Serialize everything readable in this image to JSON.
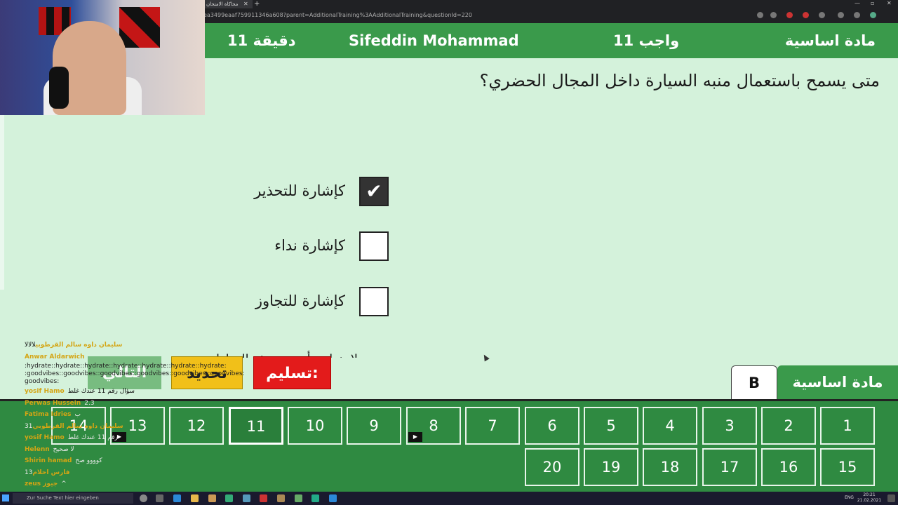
{
  "browser": {
    "tab_title": "محاكاة الامتحان",
    "url": "ea3499eaaf759911346a608?parent=AdditionalTraining%3AAdditionalTraining&questionId=220"
  },
  "header": {
    "subject": "مادة اساسية",
    "assignment": "واجب 11",
    "student_name": "Sifeddin Mohammad",
    "time_left": "11 دقيقة"
  },
  "question": {
    "text": "متى يسمح باستعمال منبه السيارة داخل المجال الحضري؟",
    "answers": [
      {
        "label": "كإشارة للتحذير",
        "checked": true
      },
      {
        "label": "كإشارة نداء",
        "checked": false
      },
      {
        "label": "كإشارة للتجاوز",
        "checked": false
      }
    ],
    "check_mark": "✔",
    "partial_text": "لا ينطبق أي من هذه الخيارات"
  },
  "actions": {
    "next": "التالي",
    "mark": "تحديد",
    "submit": "تسليم:"
  },
  "section_tabs": {
    "variant": "B",
    "subject": "مادة اساسية"
  },
  "question_nav": {
    "current": "11",
    "row1": [
      "14",
      "13",
      "12",
      "11",
      "10",
      "9",
      "8",
      "7",
      "6",
      "5",
      "4",
      "3",
      "2",
      "1"
    ],
    "row2": [
      "20",
      "19",
      "18",
      "17",
      "16",
      "15"
    ],
    "flag_glyph": "▶"
  },
  "chat": {
    "hydrate_text": ":hydrate::hydrate::hydrate::hydrate::hydrate::hydrate::hydrate: :goodvibes::goodvibes::goodvibes::goodvibes::goodvibes::goodvibes: goodvibes:",
    "lines": [
      {
        "user": "سليمان داوه سالم القرطوبي",
        "msg": "لالالا"
      },
      {
        "user": "Anwar Aldarwich",
        "msg": ""
      },
      {
        "user": "yosif Hamo",
        "msg": "سؤال رقم 11 عندك غلط"
      },
      {
        "user": "Perwas Hussein",
        "msg": "2.3"
      },
      {
        "user": "Fatima Idries",
        "msg": "ب"
      },
      {
        "user": "سليمان داوه سالم القرطوبي",
        "msg": "31"
      },
      {
        "user": "yosif Hamo",
        "msg": "رقم 11 عندك غلط"
      },
      {
        "user": "Helenn",
        "msg": "لا صحيح"
      },
      {
        "user": "Shirin hamad",
        "msg": "كوووو صح"
      },
      {
        "user": "فارس احلام",
        "msg": "13"
      },
      {
        "user": "zeus جيوز",
        "msg": "^"
      }
    ]
  },
  "taskbar": {
    "search_placeholder": "Zur Suche Text hier eingeben",
    "time": "20:21",
    "date": "21.02.2021",
    "lang": "ENG"
  }
}
